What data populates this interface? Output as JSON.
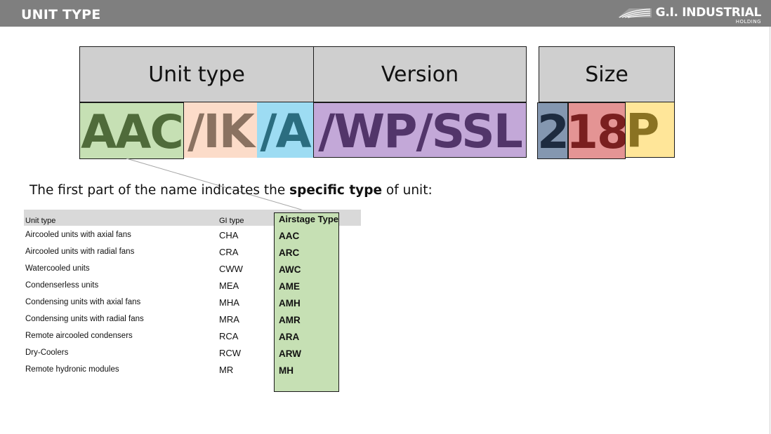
{
  "header": {
    "title": "UNIT TYPE",
    "logo_text": "G.I. INDUSTRIAL",
    "logo_sub": "HOLDING"
  },
  "diagram": {
    "headers": [
      "Unit type",
      "Version",
      "Size"
    ],
    "segments": [
      {
        "text": "AAC",
        "bg": "#c6e0b4",
        "fg": "#4f6b3a"
      },
      {
        "text": "/IK",
        "bg": "#fcdcc9",
        "fg": "#8a7261"
      },
      {
        "text": "/A",
        "bg": "#9ddcf3",
        "fg": "#2b6d80"
      },
      {
        "text": "/WP/SSL",
        "bg": "#c3a8d8",
        "fg": "#52356a"
      },
      {
        "text": "2",
        "bg": "#8497b0",
        "fg": "#1d2b3f"
      },
      {
        "text": "18",
        "bg": "#e49494",
        "fg": "#7a1f1f"
      },
      {
        "text": "P",
        "bg": "#ffe699",
        "fg": "#8a7222"
      }
    ]
  },
  "intro": {
    "before": "The first part of the name indicates the ",
    "bold": "specific type",
    "after": " of unit:"
  },
  "table": {
    "headers": [
      "Unit type",
      "GI type",
      "Airstage Type"
    ],
    "rows": [
      [
        "Aircooled units with axial fans",
        "CHA",
        "AAC"
      ],
      [
        "Aircooled units with radial fans",
        "CRA",
        "ARC"
      ],
      [
        "Watercooled units",
        "CWW",
        "AWC"
      ],
      [
        "Condenserless units",
        "MEA",
        "AME"
      ],
      [
        "Condensing units with axial fans",
        "MHA",
        "AMH"
      ],
      [
        "Condensing units with radial fans",
        "MRA",
        "AMR"
      ],
      [
        "Remote aircooled condensers",
        "RCA",
        "ARA"
      ],
      [
        "Dry-Coolers",
        "RCW",
        "ARW"
      ],
      [
        "Remote hydronic modules",
        "MR",
        "MH"
      ]
    ]
  }
}
